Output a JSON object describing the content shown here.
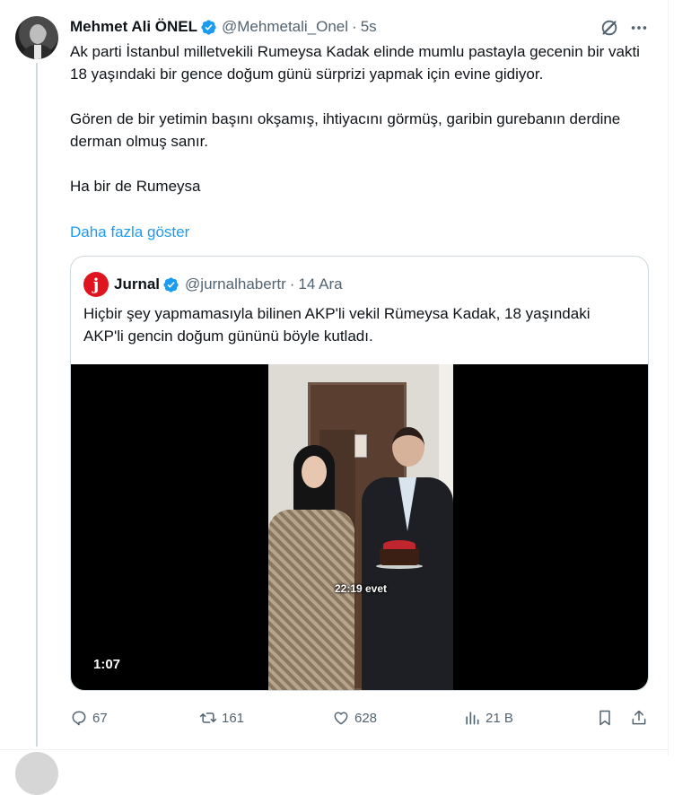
{
  "tweet": {
    "author_name": "Mehmet Ali ÖNEL",
    "handle": "@Mehmetali_Onel",
    "separator": "·",
    "time": "5s",
    "paragraphs": [
      "Ak parti İstanbul milletvekili Rumeysa Kadak elinde mumlu pastayla gecenin bir vakti 18 yaşındaki bir gence doğum günü sürprizi yapmak için evine gidiyor.",
      "Gören de bir yetimin başını okşamış, ihtiyacını görmüş, garibin gurebanın derdine derman olmuş sanır.",
      "Ha bir de Rumeysa"
    ],
    "show_more": "Daha fazla göster",
    "icons": {
      "verified": "verified-badge-icon",
      "grok": "grok-icon",
      "more": "more-dots-icon"
    }
  },
  "quote": {
    "author_name": "Jurnal",
    "logo_letter": "j",
    "handle": "@jurnalhabertr",
    "separator": "·",
    "time": "14 Ara",
    "text": "Hiçbir şey yapmamasıyla bilinen AKP'li vekil Rümeysa Kadak, 18 yaşındaki AKP'li gencin doğum gününü böyle kutladı.",
    "video": {
      "caption": "22:19 evet",
      "duration": "1:07"
    }
  },
  "actions": {
    "reply_count": "67",
    "retweet_count": "161",
    "like_count": "628",
    "views_count": "21 B",
    "icons": [
      "reply-icon",
      "retweet-icon",
      "like-icon",
      "views-icon",
      "bookmark-icon",
      "share-icon"
    ]
  },
  "colors": {
    "link": "#1d9bf0",
    "secondary_text": "#536471",
    "primary_text": "#0f1419",
    "verified": "#1d9bf0",
    "jurnal_logo": "#e0141e"
  }
}
